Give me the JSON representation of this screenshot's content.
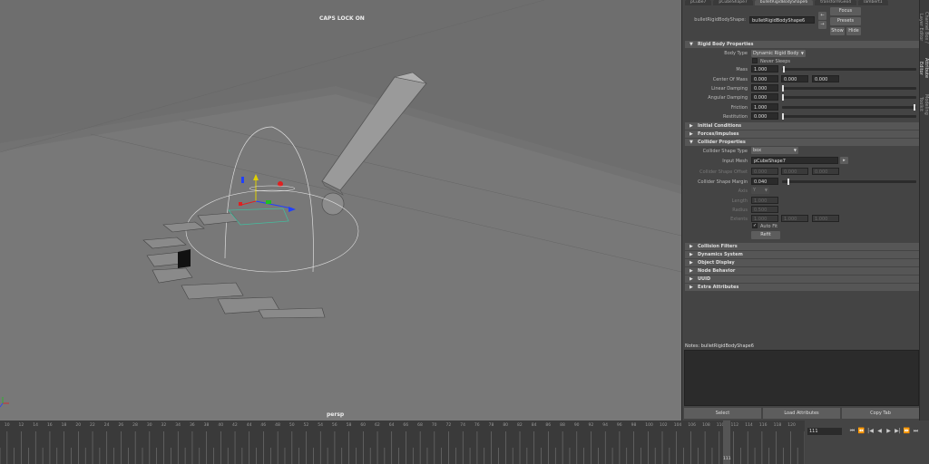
{
  "viewport": {
    "caps_lock": "CAPS LOCK ON",
    "camera": "persp"
  },
  "node_tabs": [
    "pCube7",
    "pCubeShape7",
    "bulletRigidBodyShape6",
    "transformGeo4",
    "lambert1"
  ],
  "header": {
    "node_label": "bulletRigidBodyShape:",
    "node_value": "bulletRigidBodyShape6",
    "focus": "Focus",
    "presets": "Presets",
    "show": "Show",
    "hide": "Hide"
  },
  "sections": {
    "rigid_body": "Rigid Body Properties",
    "initial_conditions": "Initial Conditions",
    "forces": "Forces/Impulses",
    "collider": "Collider Properties",
    "collision_filters": "Collision Filters",
    "dynamics_system": "Dynamics System",
    "object_display": "Object Display",
    "node_behavior": "Node Behavior",
    "uuid": "UUID",
    "extra_attributes": "Extra Attributes"
  },
  "rigid_body": {
    "body_type_label": "Body Type",
    "body_type_value": "Dynamic Rigid Body",
    "never_sleeps_label": "Never Sleeps",
    "mass_label": "Mass",
    "mass_value": "1.000",
    "com_label": "Center Of Mass",
    "com_values": [
      "0.000",
      "0.000",
      "0.000"
    ],
    "linear_damping_label": "Linear Damping",
    "linear_damping_value": "0.000",
    "angular_damping_label": "Angular Damping",
    "angular_damping_value": "0.000",
    "friction_label": "Friction",
    "friction_value": "1.000",
    "restitution_label": "Restitution",
    "restitution_value": "0.000"
  },
  "collider": {
    "shape_type_label": "Collider Shape Type",
    "shape_type_value": "box",
    "input_mesh_label": "Input Mesh",
    "input_mesh_value": "pCubeShape7",
    "offset_label": "Collider Shape Offset",
    "offset_values": [
      "0.000",
      "0.000",
      "0.000"
    ],
    "margin_label": "Collider Shape Margin",
    "margin_value": "0.040",
    "axis_label": "Axis",
    "axis_value": "Y",
    "length_label": "Length",
    "length_value": "1.000",
    "radius_label": "Radius",
    "radius_value": "0.500",
    "extents_label": "Extents",
    "extents_values": [
      "1.000",
      "1.000",
      "1.000"
    ],
    "auto_fit_label": "Auto Fit",
    "refit_label": "Refit"
  },
  "notes": {
    "label": "Notes: bulletRigidBodyShape6"
  },
  "bottom_buttons": {
    "select": "Select",
    "load": "Load Attributes",
    "copy": "Copy Tab"
  },
  "side_tabs": [
    "Channel Box / Layer Editor",
    "Attribute Editor",
    "Modeling Toolkit"
  ],
  "timeline": {
    "ticks": [
      "10",
      "12",
      "14",
      "16",
      "18",
      "20",
      "22",
      "24",
      "26",
      "28",
      "30",
      "32",
      "34",
      "36",
      "38",
      "40",
      "42",
      "44",
      "46",
      "48",
      "50",
      "52",
      "54",
      "56",
      "58",
      "60",
      "62",
      "64",
      "66",
      "68",
      "70",
      "72",
      "74",
      "76",
      "78",
      "80",
      "82",
      "84",
      "86",
      "88",
      "90",
      "92",
      "94",
      "96",
      "98",
      "100",
      "102",
      "104",
      "106",
      "108",
      "110",
      "112",
      "114",
      "116",
      "118",
      "120"
    ],
    "current_frame": "111",
    "playhead_label": "111"
  },
  "colors": {
    "viewport_bg": "#6e6e6e",
    "panel_bg": "#444444",
    "section_bg": "#565656"
  }
}
